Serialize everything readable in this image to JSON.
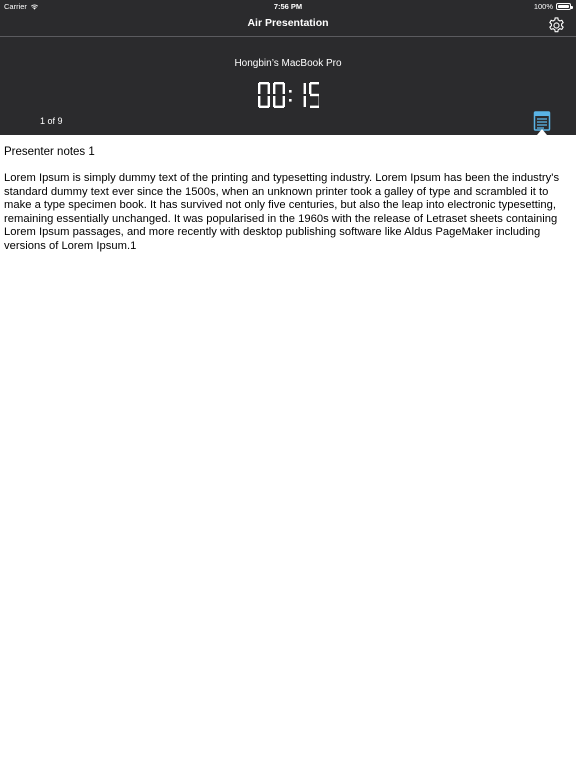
{
  "status_bar": {
    "carrier": "Carrier",
    "time": "7:56 PM",
    "battery": "100%"
  },
  "nav": {
    "title": "Air Presentation",
    "settings_icon": "gear-icon"
  },
  "presentation": {
    "device_name": "Hongbin’s MacBook Pro",
    "timer": "00:15",
    "slide_counter": "1 of 9",
    "notes_icon": "document-notes-icon"
  },
  "notes": {
    "title": "Presenter notes 1",
    "body": "Lorem Ipsum is simply dummy text of the printing and typesetting industry. Lorem Ipsum has been the industry's standard dummy text ever since the 1500s, when an unknown printer took a galley of type and scrambled it to make a type specimen book. It has survived not only five centuries, but also the leap into electronic typesetting, remaining essentially unchanged. It was popularised in the 1960s with the release of Letraset sheets containing Lorem Ipsum passages, and more recently with desktop publishing software like Aldus PageMaker including versions of Lorem Ipsum.1"
  },
  "colors": {
    "header_bg": "#2b2b2d",
    "accent_blue": "#5ab4e6",
    "text_white": "#ffffff"
  }
}
